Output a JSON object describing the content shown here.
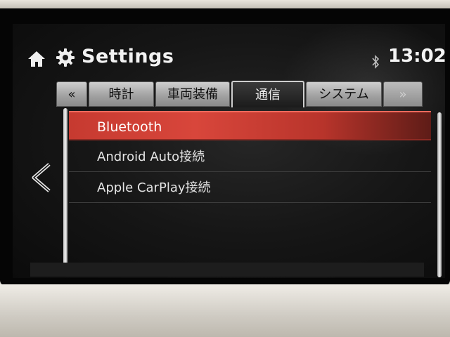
{
  "header": {
    "title": "Settings",
    "clock": "13:02",
    "icons": [
      "home-icon",
      "gear-icon",
      "bluetooth-status-icon"
    ]
  },
  "tabs": [
    {
      "label": "«",
      "state": "normal"
    },
    {
      "label": "時計",
      "state": "normal"
    },
    {
      "label": "車両装備",
      "state": "normal"
    },
    {
      "label": "通信",
      "state": "active"
    },
    {
      "label": "システム",
      "state": "normal"
    },
    {
      "label": "»",
      "state": "disabled"
    }
  ],
  "list": {
    "items": [
      {
        "label": "Bluetooth",
        "selected": true
      },
      {
        "label": "Android Auto接続",
        "selected": false
      },
      {
        "label": "Apple CarPlay接続",
        "selected": false
      }
    ]
  },
  "nav": {
    "back_icon": "chevron-left-icon"
  },
  "colors": {
    "selected_row": "#d0443a",
    "screen_bg": "#161616",
    "text": "#e4e4e4"
  }
}
